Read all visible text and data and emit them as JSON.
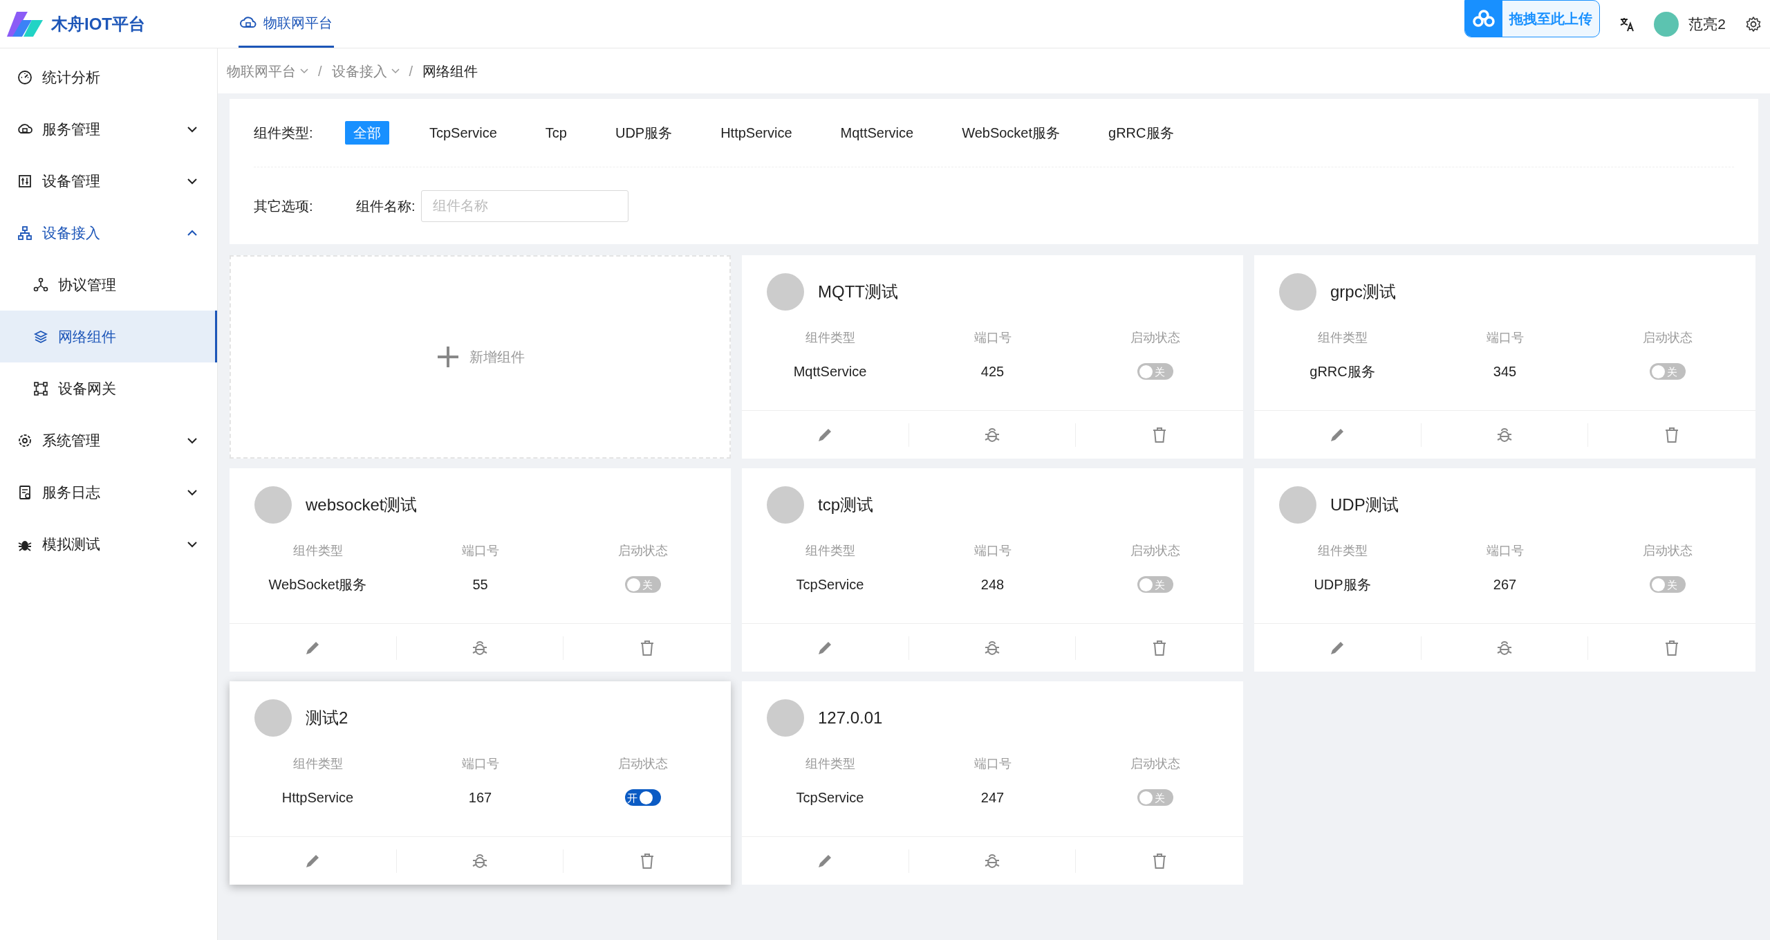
{
  "header": {
    "logo_text": "木舟IOT平台",
    "tabs": [
      {
        "label": "物联网平台",
        "selected": true
      }
    ],
    "upload_button": "拖拽至此上传",
    "user_name": "范亮2"
  },
  "sidebar": {
    "items": [
      {
        "label": "统计分析",
        "kind": "link",
        "selected": false
      },
      {
        "label": "服务管理",
        "kind": "group",
        "expanded": false,
        "selected": false
      },
      {
        "label": "设备管理",
        "kind": "group",
        "expanded": false,
        "selected": false
      },
      {
        "label": "设备接入",
        "kind": "group",
        "expanded": true,
        "selected": true,
        "children": [
          {
            "label": "协议管理",
            "kind": "link",
            "selected": false
          },
          {
            "label": "网络组件",
            "kind": "link",
            "selected": true
          },
          {
            "label": "设备网关",
            "kind": "link",
            "selected": false
          }
        ]
      },
      {
        "label": "系统管理",
        "kind": "group",
        "expanded": false,
        "selected": false
      },
      {
        "label": "服务日志",
        "kind": "group",
        "expanded": false,
        "selected": false
      },
      {
        "label": "模拟测试",
        "kind": "group",
        "expanded": false,
        "selected": false
      }
    ]
  },
  "breadcrumb": [
    {
      "label": "物联网平台",
      "kind": "menu"
    },
    {
      "separator": "/",
      "label": "设备接入",
      "kind": "menu"
    },
    {
      "separator": "/",
      "label": "网络组件",
      "kind": "current"
    }
  ],
  "filter": {
    "type_label": "组件类型:",
    "options": [
      {
        "label": "全部",
        "selected": true
      },
      {
        "label": "TcpService",
        "selected": false
      },
      {
        "label": "Tcp",
        "selected": false
      },
      {
        "label": "UDP服务",
        "selected": false
      },
      {
        "label": "HttpService",
        "selected": false
      },
      {
        "label": "MqttService",
        "selected": false
      },
      {
        "label": "WebSocket服务",
        "selected": false
      },
      {
        "label": "gRRC服务",
        "selected": false
      }
    ],
    "other_label": "其它选项:",
    "name_label": "组件名称:",
    "name_placeholder": "组件名称"
  },
  "add_card": {
    "label": "新增组件"
  },
  "components": [
    {
      "name": "MQTT测试",
      "type_label": "组件类型",
      "type": "MqttService",
      "port_label": "端口号",
      "port": "425",
      "status_label": "启动状态",
      "on": false,
      "switch_text": "关",
      "hovered": false
    },
    {
      "name": "grpc测试",
      "type_label": "组件类型",
      "type": "gRRC服务",
      "port_label": "端口号",
      "port": "345",
      "status_label": "启动状态",
      "on": false,
      "switch_text": "关",
      "hovered": false
    },
    {
      "name": "websocket测试",
      "type_label": "组件类型",
      "type": "WebSocket服务",
      "port_label": "端口号",
      "port": "55",
      "status_label": "启动状态",
      "on": false,
      "switch_text": "关",
      "hovered": false
    },
    {
      "name": "tcp测试",
      "type_label": "组件类型",
      "type": "TcpService",
      "port_label": "端口号",
      "port": "248",
      "status_label": "启动状态",
      "on": false,
      "switch_text": "关",
      "hovered": false
    },
    {
      "name": "UDP测试",
      "type_label": "组件类型",
      "type": "UDP服务",
      "port_label": "端口号",
      "port": "267",
      "status_label": "启动状态",
      "on": false,
      "switch_text": "关",
      "hovered": false
    },
    {
      "name": "测试2",
      "type_label": "组件类型",
      "type": "HttpService",
      "port_label": "端口号",
      "port": "167",
      "status_label": "启动状态",
      "on": true,
      "switch_text": "开",
      "hovered": true
    },
    {
      "name": "127.0.01",
      "type_label": "组件类型",
      "type": "TcpService",
      "port_label": "端口号",
      "port": "247",
      "status_label": "启动状态",
      "on": false,
      "switch_text": "关",
      "hovered": false
    }
  ]
}
